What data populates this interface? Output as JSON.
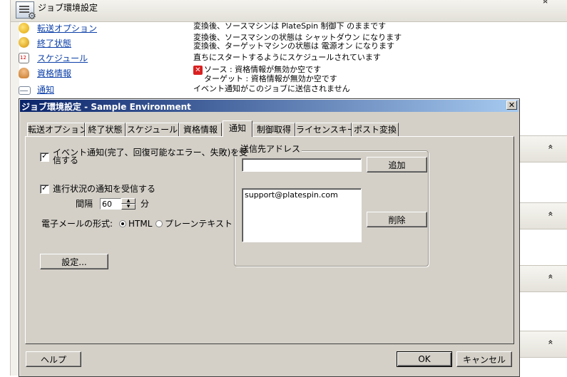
{
  "background": {
    "title": "ジョブ環境設定",
    "rows": [
      {
        "label": "転送オプション",
        "value_lines": [
          "変換後、ソースマシンは PlateSpin 制御下 のままです"
        ]
      },
      {
        "label": "終了状態",
        "value_lines": [
          "変換後、ソースマシンの状態は シャットダウン になります",
          "変換後、ターゲットマシンの状態は 電源オン になります"
        ]
      },
      {
        "label": "スケジュール",
        "value_lines": [
          "直ちにスタートするようにスケジュールされています"
        ]
      },
      {
        "label": "資格情報",
        "value_lines": [
          "ソース : 資格情報が無効か空です",
          "ターゲット : 資格情報が無効か空です"
        ]
      },
      {
        "label": "通知",
        "value_lines": [
          "イベント通知がこのジョブに送信されません"
        ]
      }
    ],
    "collapse_glyph": "»"
  },
  "dialog": {
    "title": "ジョブ環境設定 - Sample Environment",
    "close_glyph": "✕",
    "tabs": [
      {
        "label": "転送オプション"
      },
      {
        "label": "終了状態"
      },
      {
        "label": "スケジュール"
      },
      {
        "label": "資格情報"
      },
      {
        "label": "通知",
        "active": true
      },
      {
        "label": "制御取得"
      },
      {
        "label": "ライセンスキー"
      },
      {
        "label": "ポスト変換"
      }
    ],
    "notification": {
      "event_checkbox": {
        "line1": "イベント通知(完了、回復可能なエラー、失敗)を受",
        "line2": "信する",
        "checked": true
      },
      "progress_checkbox": {
        "label": "進行状況の通知を受信する",
        "checked": true
      },
      "interval_label": "間隔",
      "interval_value": "60",
      "interval_unit": "分",
      "email_format_label": "電子メールの形式:",
      "format_html": "HTML",
      "format_plain": "プレーンテキスト",
      "settings_button": "設定..."
    },
    "recipients": {
      "legend": "送信先アドレス",
      "address_value": "",
      "add_button": "追加",
      "items": [
        "support@platespin.com"
      ],
      "delete_button": "削除"
    },
    "footer": {
      "help": "ヘルプ",
      "ok": "OK",
      "cancel": "キャンセル"
    }
  }
}
